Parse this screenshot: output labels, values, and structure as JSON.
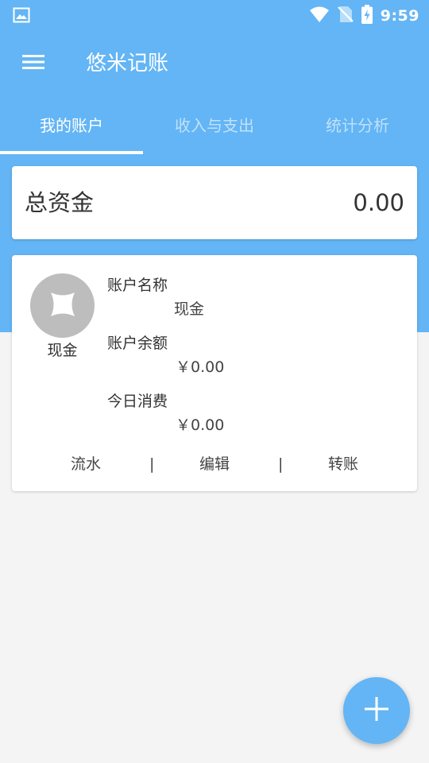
{
  "status_bar": {
    "time": "9:59",
    "icons": [
      "image-icon",
      "wifi-icon",
      "no-sim-icon",
      "battery-charging-icon"
    ]
  },
  "app_bar": {
    "title": "悠米记账",
    "menu_icon": "menu-icon"
  },
  "tabs": [
    {
      "label": "我的账户",
      "active": true
    },
    {
      "label": "收入与支出",
      "active": false
    },
    {
      "label": "统计分析",
      "active": false
    }
  ],
  "total": {
    "label": "总资金",
    "value": "0.00"
  },
  "account": {
    "name": "现金",
    "name_label": "账户名称",
    "name_value": "现金",
    "balance_label": "账户余额",
    "balance_value": "￥0.00",
    "today_label": "今日消费",
    "today_value": "￥0.00",
    "actions": {
      "flow": "流水",
      "edit": "编辑",
      "transfer": "转账",
      "separator": "|"
    }
  },
  "fab": {
    "icon": "plus-icon"
  },
  "colors": {
    "primary": "#63b5f5",
    "background": "#f4f4f4",
    "card": "#ffffff",
    "avatar": "#bdbdbd"
  }
}
